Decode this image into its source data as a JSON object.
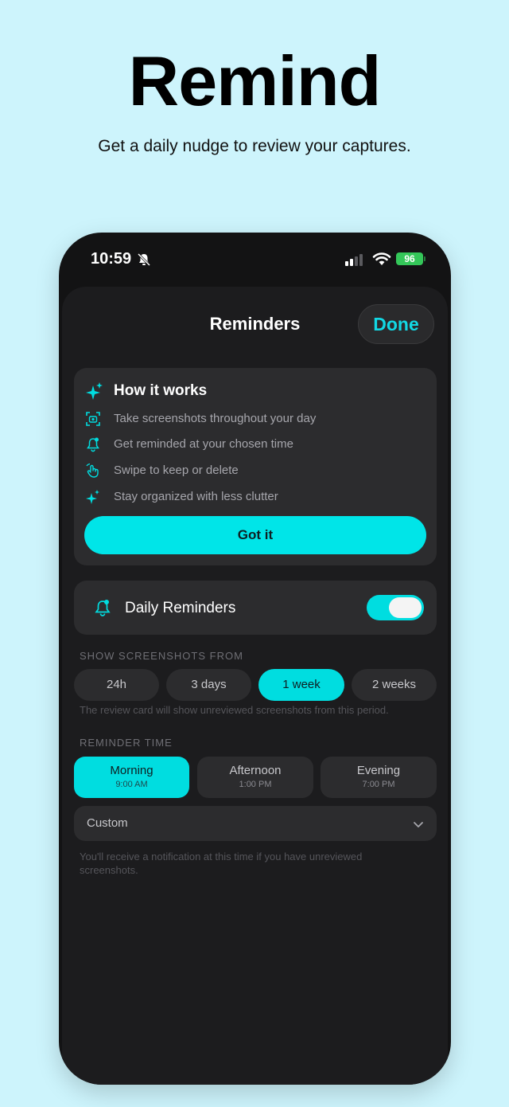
{
  "hero": {
    "title": "Remind",
    "subtitle": "Get a daily nudge to review your captures."
  },
  "status_bar": {
    "time": "10:59",
    "battery": "96"
  },
  "sheet": {
    "title": "Reminders",
    "done_label": "Done"
  },
  "how_it_works": {
    "title": "How it works",
    "items": [
      {
        "icon": "screenshot-icon",
        "text": "Take screenshots throughout your day"
      },
      {
        "icon": "bell-icon",
        "text": "Get reminded at your chosen time"
      },
      {
        "icon": "swipe-icon",
        "text": "Swipe to keep or delete"
      },
      {
        "icon": "sparkle-icon",
        "text": "Stay organized with less clutter"
      }
    ],
    "button_label": "Got it"
  },
  "daily_reminders": {
    "label": "Daily Reminders",
    "enabled": true
  },
  "screenshots_from": {
    "label": "SHOW SCREENSHOTS FROM",
    "options": [
      "24h",
      "3 days",
      "1 week",
      "2 weeks"
    ],
    "selected": "1 week",
    "hint": "The review card will show unreviewed screenshots from this period."
  },
  "reminder_time": {
    "label": "REMINDER TIME",
    "options": [
      {
        "name": "Morning",
        "time": "9:00 AM"
      },
      {
        "name": "Afternoon",
        "time": "1:00 PM"
      },
      {
        "name": "Evening",
        "time": "7:00 PM"
      }
    ],
    "selected": "Morning",
    "custom_label": "Custom",
    "hint": "You'll receive a notification at this time if you have unreviewed screenshots."
  },
  "colors": {
    "accent": "#00dde0",
    "background": "#cdf4fc",
    "sheet": "#1c1c1e",
    "card": "#2c2c2e",
    "battery": "#34c759"
  }
}
